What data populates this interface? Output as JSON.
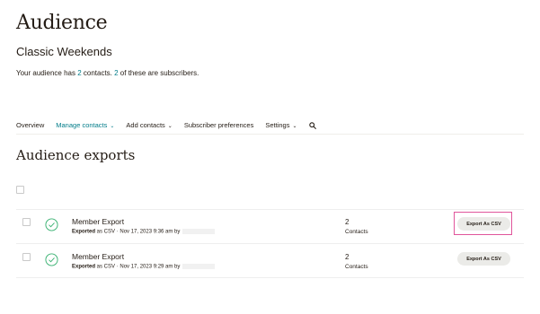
{
  "header": {
    "title": "Audience",
    "audience_name": "Classic Weekends",
    "summary": {
      "part1": "Your audience has ",
      "contacts_count": "2",
      "part2": " contacts. ",
      "subscribers_count": "2",
      "part3": " of these are subscribers."
    }
  },
  "nav": {
    "overview": "Overview",
    "manage_contacts": "Manage contacts",
    "add_contacts": "Add contacts",
    "subscriber_preferences": "Subscriber preferences",
    "settings": "Settings",
    "chevron": "⌄",
    "search_icon": "search-icon"
  },
  "section": {
    "title": "Audience exports"
  },
  "exports": [
    {
      "name": "Member Export",
      "exported_bold": "Exported",
      "details": " as CSV · Nov 17, 2023 9:36 am by",
      "count": "2",
      "count_label": "Contacts",
      "button_label": "Export As CSV"
    },
    {
      "name": "Member Export",
      "exported_bold": "Exported",
      "details": " as CSV · Nov 17, 2023 9:29 am by",
      "count": "2",
      "count_label": "Contacts",
      "button_label": "Export As CSV"
    }
  ],
  "colors": {
    "accent": "#007c89",
    "highlight": "#e0559b",
    "success": "#3bb273"
  }
}
